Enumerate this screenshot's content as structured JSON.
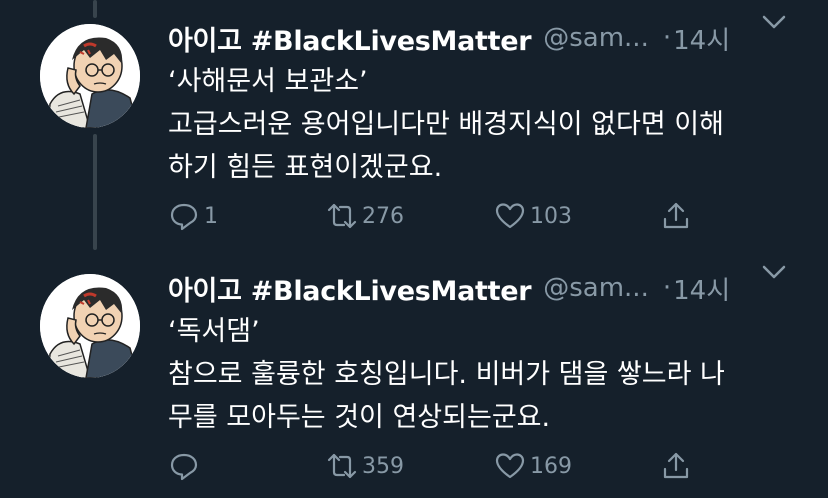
{
  "tweets": [
    {
      "author": {
        "display_name": "아이고 #BlackLivesMatter",
        "handle": "@sam...",
        "time": "14시"
      },
      "lines": [
        "‘사해문서 보관소’",
        "고급스러운 용어입니다만 배경지식이 없다면 이해",
        "하기 힘든 표현이겠군요."
      ],
      "actions": {
        "replies": "1",
        "retweets": "276",
        "likes": "103"
      }
    },
    {
      "author": {
        "display_name": "아이고 #BlackLivesMatter",
        "handle": "@sam...",
        "time": "14시"
      },
      "lines": [
        "‘독서댐’",
        "참으로 훌륭한 호칭입니다. 비버가 댐을 쌓느라 나",
        "무를 모아두는 것이 연상되는군요."
      ],
      "actions": {
        "replies": "",
        "retweets": "359",
        "likes": "169"
      }
    }
  ],
  "separator": "·",
  "icons": [
    "reply-icon",
    "retweet-icon",
    "like-icon",
    "share-icon",
    "chevron-down-icon"
  ],
  "colors": {
    "background": "#15202b",
    "secondary_text": "#8899a6",
    "thread_line": "#38444d"
  }
}
